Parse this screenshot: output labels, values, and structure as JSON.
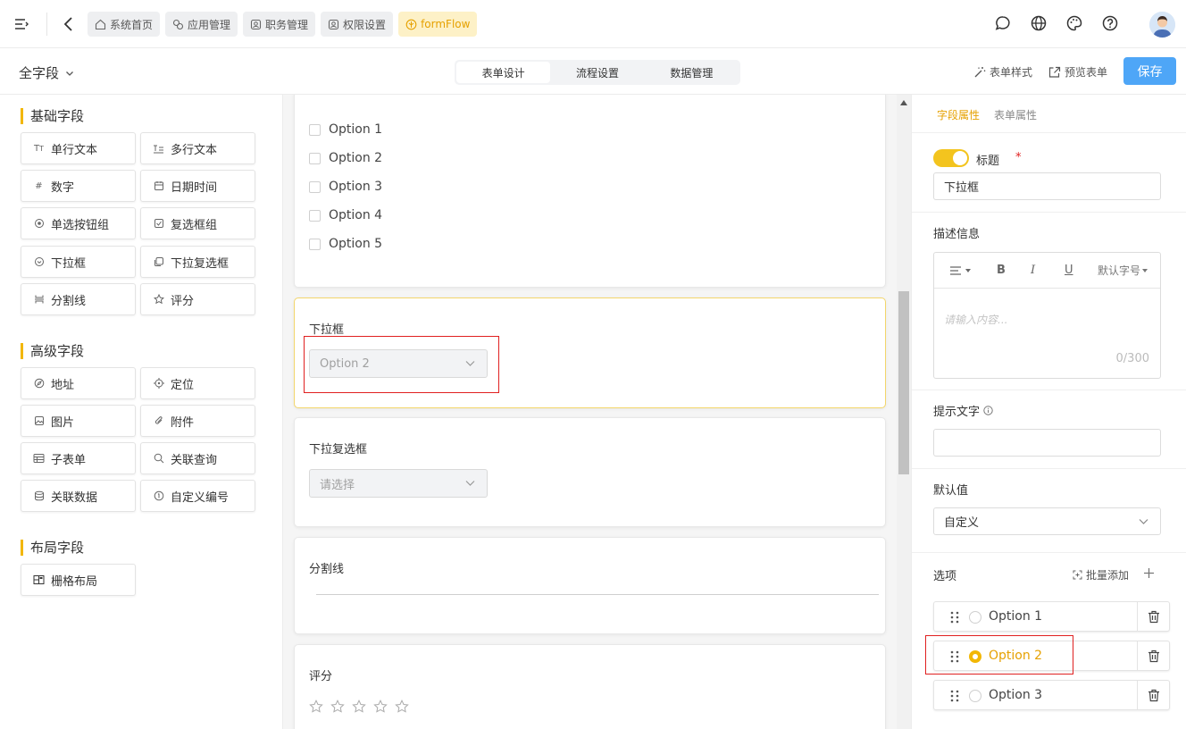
{
  "header": {
    "tabs": [
      {
        "label": "系统首页",
        "icon": "home-icon"
      },
      {
        "label": "应用管理",
        "icon": "app-icon"
      },
      {
        "label": "职务管理",
        "icon": "user-badge-icon"
      },
      {
        "label": "权限设置",
        "icon": "user-badge-icon"
      },
      {
        "label": "formFlow",
        "icon": "flower-icon",
        "active": true
      }
    ],
    "right_icons": [
      "chat-icon",
      "globe-icon",
      "palette-icon",
      "help-icon",
      "avatar"
    ]
  },
  "toolbar": {
    "field_scope": "全字段",
    "segments": [
      "表单设计",
      "流程设置",
      "数据管理"
    ],
    "active_segment": "表单设计",
    "form_style_label": "表单样式",
    "preview_label": "预览表单",
    "save_label": "保存"
  },
  "left": {
    "basic_title": "基础字段",
    "basic_fields": [
      {
        "label": "单行文本",
        "icon": "text-icon"
      },
      {
        "label": "多行文本",
        "icon": "multiline-text-icon"
      },
      {
        "label": "数字",
        "icon": "hash-icon"
      },
      {
        "label": "日期时间",
        "icon": "calendar-icon"
      },
      {
        "label": "单选按钮组",
        "icon": "radio-icon"
      },
      {
        "label": "复选框组",
        "icon": "checkbox-icon"
      },
      {
        "label": "下拉框",
        "icon": "dropdown-icon"
      },
      {
        "label": "下拉复选框",
        "icon": "multi-dropdown-icon"
      },
      {
        "label": "分割线",
        "icon": "divider-icon"
      },
      {
        "label": "评分",
        "icon": "star-icon"
      }
    ],
    "advanced_title": "高级字段",
    "advanced_fields": [
      {
        "label": "地址",
        "icon": "compass-icon"
      },
      {
        "label": "定位",
        "icon": "locate-icon"
      },
      {
        "label": "图片",
        "icon": "image-icon"
      },
      {
        "label": "附件",
        "icon": "paperclip-icon"
      },
      {
        "label": "子表单",
        "icon": "table-icon"
      },
      {
        "label": "关联查询",
        "icon": "search-icon"
      },
      {
        "label": "关联数据",
        "icon": "database-icon"
      },
      {
        "label": "自定义编号",
        "icon": "number-icon"
      }
    ],
    "layout_title": "布局字段",
    "layout_fields": [
      {
        "label": "栅格布局",
        "icon": "grid-icon"
      }
    ]
  },
  "canvas": {
    "checkbox_options": [
      "Option 1",
      "Option 2",
      "Option 3",
      "Option 4",
      "Option 5"
    ],
    "dropdown": {
      "label": "下拉框",
      "value": "Option 2"
    },
    "multi_dropdown": {
      "label": "下拉复选框",
      "placeholder": "请选择"
    },
    "divider": {
      "label": "分割线"
    },
    "rating": {
      "label": "评分",
      "stars": 5
    }
  },
  "props": {
    "tabs": [
      "字段属性",
      "表单属性"
    ],
    "active_tab": "字段属性",
    "title_label": "标题",
    "title_required_mark": "*",
    "title_value": "下拉框",
    "desc_label": "描述信息",
    "editor_font_label": "默认字号",
    "editor_placeholder": "请输入内容...",
    "editor_count": "0/300",
    "hint_label": "提示文字",
    "default_label": "默认值",
    "default_value": "自定义",
    "options_label": "选项",
    "batch_add_label": "批量添加",
    "options": [
      {
        "label": "Option 1",
        "selected": false
      },
      {
        "label": "Option 2",
        "selected": true
      },
      {
        "label": "Option 3",
        "selected": false
      }
    ]
  },
  "colors": {
    "accent": "#f2b705",
    "primary_button": "#4ea6f7",
    "highlight_box": "#e02020"
  }
}
